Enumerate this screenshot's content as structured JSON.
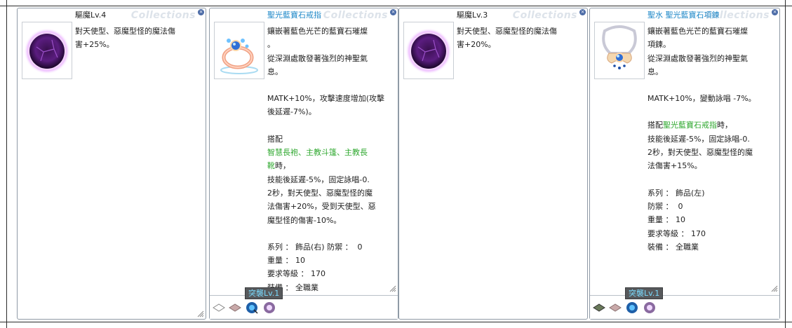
{
  "watermark": "Collections",
  "panels": [
    {
      "title": "驅魔Lv.4",
      "title_color": "#222222",
      "icon": "dark-purple-orb-icon",
      "lines": [
        [
          {
            "t": "對天使型、惡魔型怪的魔法傷"
          }
        ],
        [
          {
            "t": "害+25%。"
          }
        ]
      ]
    },
    {
      "title": "聖光藍寶石戒指",
      "title_color": "#1e88c8",
      "icon": "sapphire-ring-icon",
      "tab_label": "突襲Lv.1",
      "lines": [
        [
          {
            "t": "鑲嵌著藍色光芒的藍寶石璀燦"
          }
        ],
        [
          {
            "t": "。"
          }
        ],
        [
          {
            "t": "從深淵處散發著強烈的神聖氣"
          }
        ],
        [
          {
            "t": "息。"
          }
        ],
        [
          {
            "t": ""
          }
        ],
        [
          {
            "t": "MATK+10%，攻擊速度增加(攻擊"
          }
        ],
        [
          {
            "t": "後延遲-7%)。"
          }
        ],
        [
          {
            "t": ""
          }
        ],
        [
          {
            "t": "搭配"
          }
        ],
        [
          {
            "t": "智慧長袍、主教斗篷、主教長",
            "green": true
          }
        ],
        [
          {
            "t": "靴",
            "green": true
          },
          {
            "t": "時，"
          }
        ],
        [
          {
            "t": "技能後延遲-5%，固定詠唱-0."
          }
        ],
        [
          {
            "t": "2秒，對天使型、惡魔型怪的魔"
          }
        ],
        [
          {
            "t": "法傷害+20%，受到天使型、惡"
          }
        ],
        [
          {
            "t": "魔型怪的傷害-10%。"
          }
        ],
        [
          {
            "t": ""
          }
        ],
        [
          {
            "t": "系列 ： 飾品(右) 防禦 ：  0"
          }
        ],
        [
          {
            "t": "重量 ： 10"
          }
        ],
        [
          {
            "t": "要求等級 ： 170"
          }
        ],
        [
          {
            "t": "裝備 ： 全職業"
          }
        ]
      ]
    },
    {
      "title": "驅魔Lv.3",
      "title_color": "#222222",
      "icon": "dark-purple-orb-icon",
      "lines": [
        [
          {
            "t": "對天使型、惡魔型怪的魔法傷"
          }
        ],
        [
          {
            "t": "害+20%。"
          }
        ]
      ]
    },
    {
      "title": "聖水 聖光藍寶石項鍊",
      "title_color": "#1e88c8",
      "icon": "sapphire-necklace-icon",
      "tab_label": "突襲Lv.1",
      "lines": [
        [
          {
            "t": "鑲嵌著藍色光芒的藍寶石璀燦"
          }
        ],
        [
          {
            "t": "項鍊。"
          }
        ],
        [
          {
            "t": "從深淵處散發著強烈的神聖氣"
          }
        ],
        [
          {
            "t": "息。"
          }
        ],
        [
          {
            "t": ""
          }
        ],
        [
          {
            "t": "MATK+10%，變動詠唱 -7%。"
          }
        ],
        [
          {
            "t": ""
          }
        ],
        [
          {
            "t": "搭配"
          },
          {
            "t": "聖光藍寶石戒指",
            "green": true
          },
          {
            "t": "時，"
          }
        ],
        [
          {
            "t": "技能後延遲-5%，固定詠唱-0."
          }
        ],
        [
          {
            "t": "2秒，對天使型、惡魔型怪的魔"
          }
        ],
        [
          {
            "t": "法傷害+15%。"
          }
        ],
        [
          {
            "t": ""
          }
        ],
        [
          {
            "t": "系列 ： 飾品(左)"
          }
        ],
        [
          {
            "t": "防禦 ：  0"
          }
        ],
        [
          {
            "t": "重量 ： 10"
          }
        ],
        [
          {
            "t": "要求等級 ： 170"
          }
        ],
        [
          {
            "t": "裝備 ： 全職業"
          }
        ]
      ]
    }
  ],
  "colors": {
    "green_text": "#2fa82f",
    "blue_title": "#1e88c8",
    "tab_bg": "#57595c",
    "tab_text": "#7bdcff"
  }
}
